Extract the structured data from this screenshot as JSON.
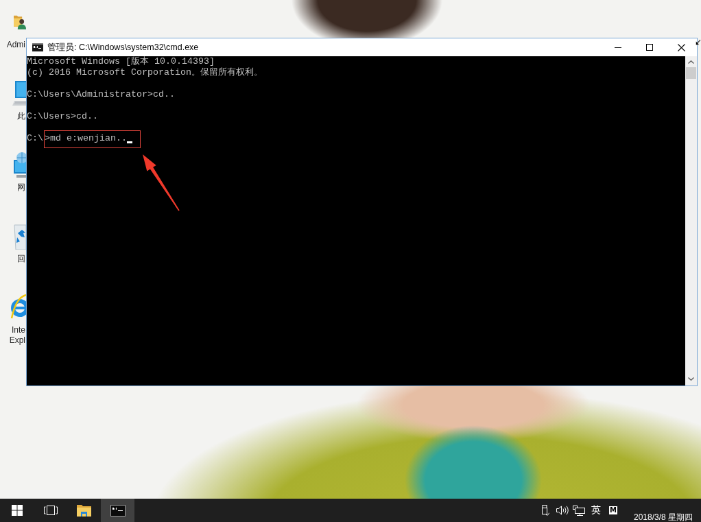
{
  "desktop": {
    "icons": [
      {
        "kind": "user_folder",
        "label_lines": [
          "Admi"
        ]
      },
      {
        "kind": "computer",
        "label_lines": [
          "此"
        ]
      },
      {
        "kind": "network",
        "label_lines": [
          "网"
        ]
      },
      {
        "kind": "recycle_bin",
        "label_lines": [
          "回"
        ]
      },
      {
        "kind": "browser",
        "label_lines": [
          "Inte",
          "Expl"
        ]
      }
    ]
  },
  "window": {
    "title": "管理员: C:\\Windows\\system32\\cmd.exe",
    "buttons": [
      {
        "kind": "minimize"
      },
      {
        "kind": "maximize"
      },
      {
        "kind": "close"
      }
    ]
  },
  "console": {
    "lines": [
      {
        "text": "Microsoft Windows [版本 10.0.14393]",
        "blank_before": false,
        "cursor": false
      },
      {
        "text": "(c) 2016 Microsoft Corporation。保留所有权利。",
        "blank_before": false,
        "cursor": false
      },
      {
        "text": "C:\\Users\\Administrator>cd..",
        "blank_before": true,
        "cursor": false
      },
      {
        "text": "C:\\Users>cd..",
        "blank_before": true,
        "cursor": false
      },
      {
        "text": "C:\\",
        "marked_text": ">md e:wenjian..",
        "blank_before": true,
        "cursor": true
      }
    ]
  },
  "taskbar": {
    "apps": [
      {
        "kind": "start",
        "active": false
      },
      {
        "kind": "task_view",
        "active": false
      },
      {
        "kind": "file_explorer",
        "active": false
      },
      {
        "kind": "console",
        "active": true
      }
    ],
    "tray": [
      {
        "kind": "usb"
      },
      {
        "kind": "volume"
      },
      {
        "kind": "network"
      }
    ],
    "language": "英",
    "ime": "M",
    "date": "2018/3/8 星期四"
  }
}
